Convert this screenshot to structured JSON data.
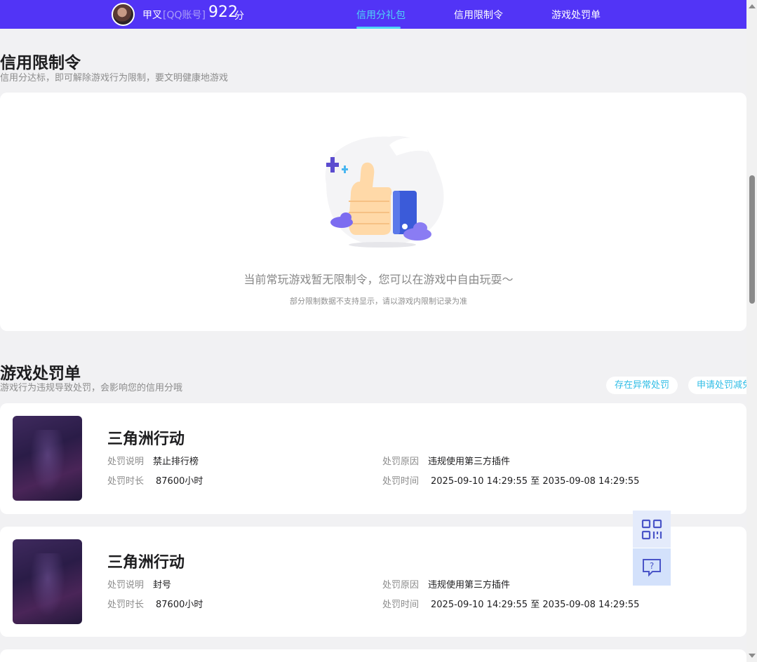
{
  "header": {
    "username": "甲叉",
    "account_tag": "[QQ账号]",
    "score": "922",
    "score_unit": "分",
    "nav": [
      {
        "label": "信用分礼包",
        "active": true
      },
      {
        "label": "信用限制令",
        "active": false
      },
      {
        "label": "游戏处罚单",
        "active": false
      }
    ],
    "active_color": "#4fd5f5",
    "bar_color": "#5234f6"
  },
  "restriction": {
    "title": "信用限制令",
    "subtitle": "信用分达标，即可解除游戏行为限制，要文明健康地游戏",
    "empty_main": "当前常玩游戏暂无限制令，您可以在游戏中自由玩耍～",
    "empty_note": "部分限制数据不支持显示，请以游戏内限制记录为准"
  },
  "penalties": {
    "title": "游戏处罚单",
    "subtitle": "游戏行为违规导致处罚，会影响您的信用分哦",
    "buttons": {
      "abnormal": "存在异常处罚",
      "appeal": "申请处罚减免"
    },
    "labels": {
      "desc": "处罚说明",
      "reason": "处罚原因",
      "duration": "处罚时长",
      "time": "处罚时间"
    },
    "items": [
      {
        "game": "三角洲行动",
        "desc": "禁止排行榜",
        "reason": "违规使用第三方插件",
        "duration": "87600小时",
        "time": "2025-09-10 14:29:55 至 2035-09-08 14:29:55"
      },
      {
        "game": "三角洲行动",
        "desc": "封号",
        "reason": "违规使用第三方插件",
        "duration": "87600小时",
        "time": "2025-09-10 14:29:55 至 2035-09-08 14:29:55"
      }
    ]
  },
  "icons": {
    "avatar": "avatar",
    "empty_illustration": "thumbs-up-icon",
    "qr": "qr-code-icon",
    "help": "help-chat-icon"
  }
}
